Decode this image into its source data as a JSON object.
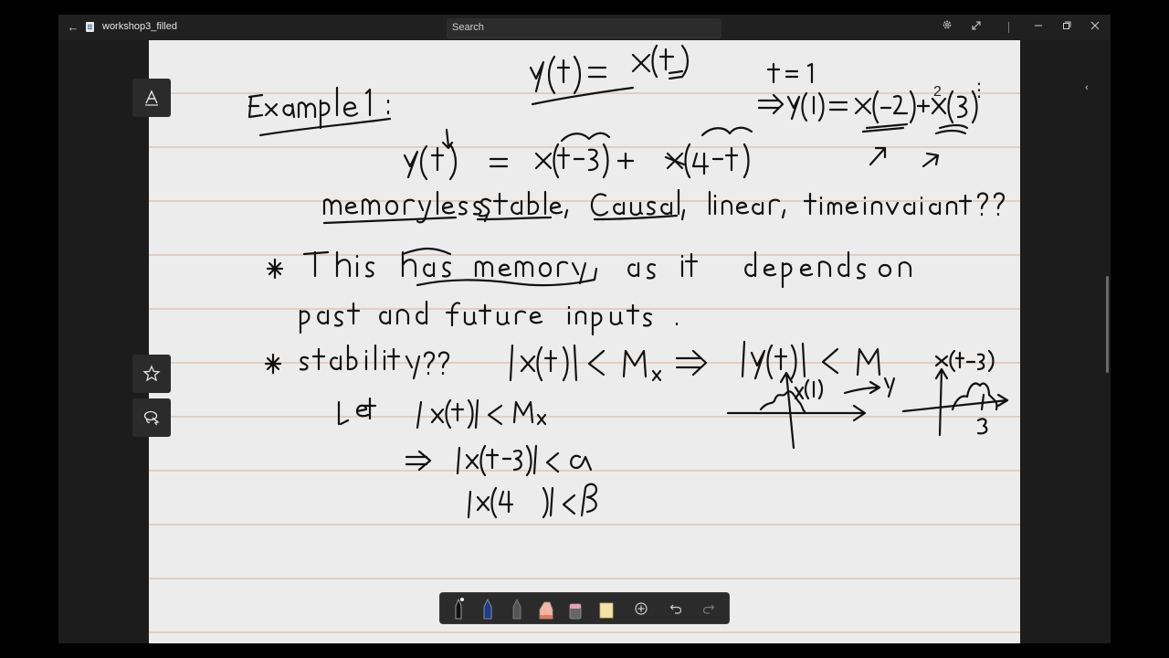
{
  "titlebar": {
    "doc_title": "workshop3_filled",
    "search_placeholder": "Search",
    "back_icon": "back-arrow-icon",
    "settings_icon": "gear-icon",
    "expand_icon": "expand-icon",
    "minimize_icon": "minimize-icon",
    "maximize_icon": "maximize-icon",
    "close_icon": "close-icon"
  },
  "page": {
    "number": "2",
    "more_icon": "more-vertical-icon"
  },
  "sidebar": {
    "text_tool": "text-tool-icon",
    "favorite": "star-icon",
    "lasso": "lasso-select-icon"
  },
  "toolbar": {
    "tools": [
      "ballpoint-pen-icon",
      "blue-pen-icon",
      "pencil-icon",
      "highlighter-icon",
      "eraser-icon",
      "ruler-icon",
      "add-icon",
      "undo-icon",
      "redo-icon"
    ]
  },
  "colors": {
    "background": "#000000",
    "chrome": "#202020",
    "page": "#ececec",
    "rule_line": "#e0cfc4",
    "ink": "#111111"
  }
}
